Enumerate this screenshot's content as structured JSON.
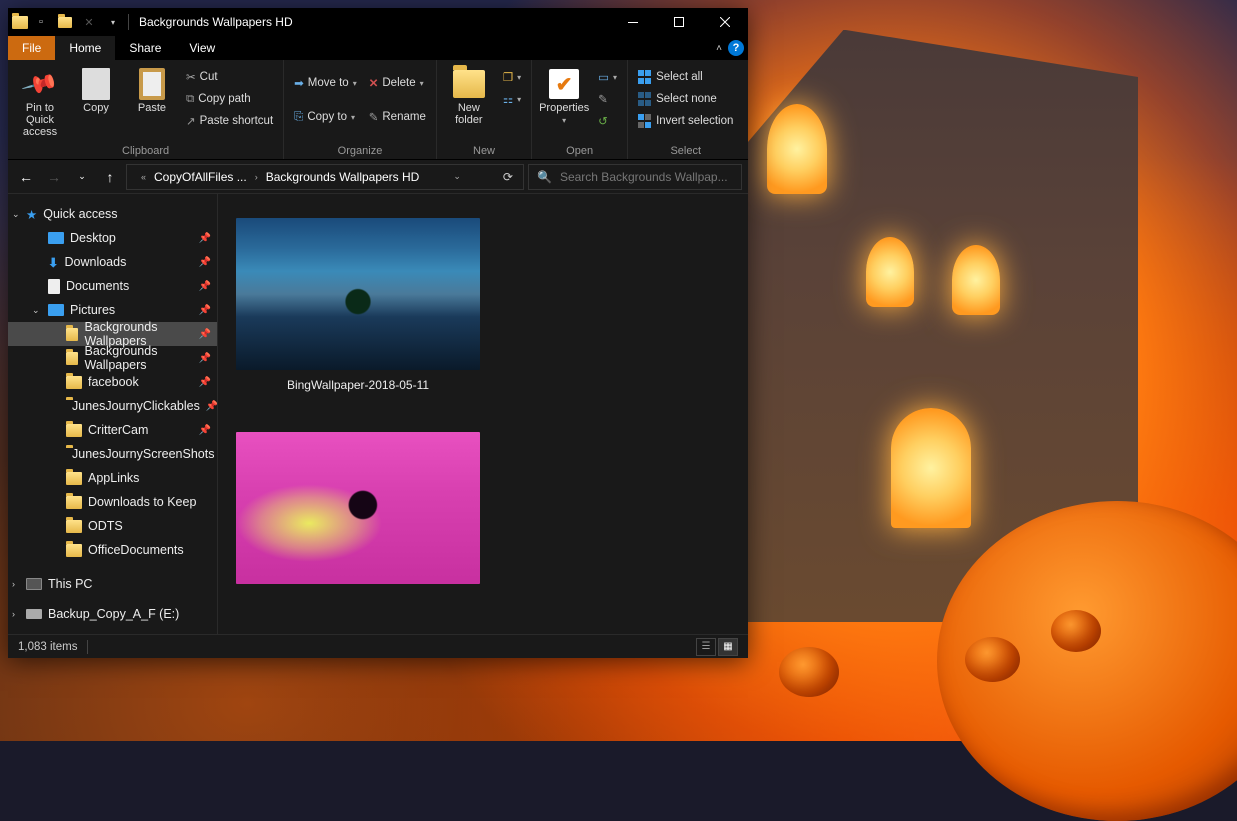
{
  "window": {
    "title": "Backgrounds Wallpapers HD"
  },
  "tabs": {
    "file": "File",
    "home": "Home",
    "share": "Share",
    "view": "View"
  },
  "ribbon": {
    "clipboard": {
      "label": "Clipboard",
      "pin": "Pin to Quick access",
      "copy": "Copy",
      "paste": "Paste",
      "cut": "Cut",
      "copypath": "Copy path",
      "pasteshortcut": "Paste shortcut"
    },
    "organize": {
      "label": "Organize",
      "moveto": "Move to",
      "copyto": "Copy to",
      "delete": "Delete",
      "rename": "Rename"
    },
    "new": {
      "label": "New",
      "newfolder": "New folder"
    },
    "open": {
      "label": "Open",
      "properties": "Properties"
    },
    "select": {
      "label": "Select",
      "selectall": "Select all",
      "selectnone": "Select none",
      "invert": "Invert selection"
    }
  },
  "address": {
    "seg1": "CopyOfAllFiles ...",
    "seg2": "Backgrounds Wallpapers HD"
  },
  "search": {
    "placeholder": "Search Backgrounds Wallpap..."
  },
  "sidebar": {
    "quickaccess": "Quick access",
    "items": [
      "Desktop",
      "Downloads",
      "Documents",
      "Pictures",
      "Backgrounds Wallpapers",
      "Backgrounds Wallpapers",
      "facebook",
      "JunesJournyClickables",
      "CritterCam",
      "JunesJournyScreenShots",
      "AppLinks",
      "Downloads to Keep",
      "ODTS",
      "OfficeDocuments"
    ],
    "thispc": "This PC",
    "drive": "Backup_Copy_A_F (E:)"
  },
  "files": {
    "item1": "BingWallpaper-2018-05-11"
  },
  "status": {
    "count": "1,083 items"
  }
}
